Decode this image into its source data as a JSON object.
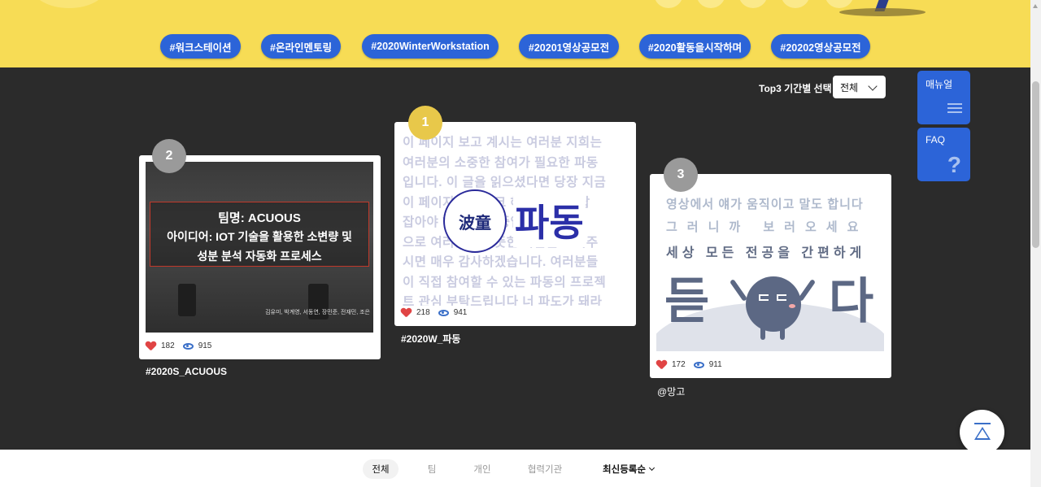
{
  "hashtags": [
    {
      "label": "#워크스테이션"
    },
    {
      "label": "#온라인멘토링"
    },
    {
      "label": "#2020WinterWorkstation"
    },
    {
      "label": "#20201영상공모전"
    },
    {
      "label": "#2020활동을시작하며"
    },
    {
      "label": "#20202영상공모전"
    }
  ],
  "top3": {
    "label": "Top3 기간별 선택",
    "selected": "전체"
  },
  "side_buttons": {
    "manual": "매뉴얼",
    "faq": "FAQ"
  },
  "cards": [
    {
      "rank": "2",
      "title": "#2020S_ACUOUS",
      "likes": "182",
      "views": "915",
      "thumb_lines": [
        "팀명: ACUOUS",
        "아이디어: IOT 기술을 활용한 소변량 및",
        "성분 분석 자동화 프로세스"
      ],
      "thumb_names": "김유미, 박계영, 서동연, 장민준, 전재민, 조은"
    },
    {
      "rank": "1",
      "title": "#2020W_파동",
      "likes": "218",
      "views": "941",
      "thumb_bg_lines": [
        "이 페이지 보고 계시는 여러분 지희는",
        "여러분의 소중한 참여가 필요한 파동",
        "입니다. 이 글을 읽으셨다면 당장 지금",
        "이 페이지를 북마크 해 주시기 바랍",
        "잡아야 하고 노력 중입니다. 클릭",
        "으로 여러분의 따뜻한 마음을 보여주",
        "시면 매우 감사하겠습니다. 여러분들",
        "이 직접 참여할 수 있는 파동의 프로젝",
        "트 관심 부탁드립니다 너 파도가 돼라"
      ],
      "thumb_logo": "波童",
      "thumb_big": "파동"
    },
    {
      "rank": "3",
      "title": "@망고",
      "likes": "172",
      "views": "911",
      "thumb_lines": [
        "영상에서 얘가 움직이고 말도 합니다",
        "그러니까 보러오세요",
        "세상 모든 전공을 간편하게"
      ],
      "thumb_big_left": "듣",
      "thumb_big_right": "다"
    }
  ],
  "filter": {
    "tabs": [
      "전체",
      "팀",
      "개인",
      "협력기관"
    ],
    "sort": "최신등록순"
  },
  "colors": {
    "header_bg": "#f7dc55",
    "tag_blue": "#2c64d8",
    "rank1": "#e8c84a",
    "rank_other": "#9a9a9a",
    "page_bg": "#2b2b2b"
  }
}
